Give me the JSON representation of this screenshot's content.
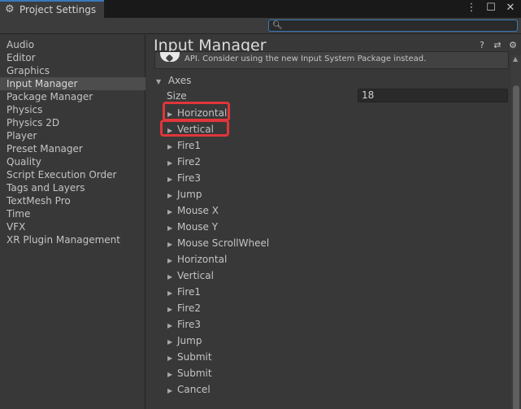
{
  "window": {
    "tab_title": "Project Settings",
    "tab_icon": "gear-icon",
    "controls": [
      "more-vert-icon",
      "maximize-icon",
      "close-icon"
    ]
  },
  "search": {
    "placeholder": "",
    "value": ""
  },
  "sidebar": {
    "items": [
      {
        "label": "Audio"
      },
      {
        "label": "Editor"
      },
      {
        "label": "Graphics"
      },
      {
        "label": "Input Manager",
        "selected": true
      },
      {
        "label": "Package Manager"
      },
      {
        "label": "Physics"
      },
      {
        "label": "Physics 2D"
      },
      {
        "label": "Player"
      },
      {
        "label": "Preset Manager"
      },
      {
        "label": "Quality"
      },
      {
        "label": "Script Execution Order"
      },
      {
        "label": "Tags and Layers"
      },
      {
        "label": "TextMesh Pro"
      },
      {
        "label": "Time"
      },
      {
        "label": "VFX"
      },
      {
        "label": "XR Plugin Management"
      }
    ]
  },
  "main": {
    "title": "Input Manager",
    "header_icons": [
      "help-icon",
      "preset-icon",
      "settings-icon"
    ],
    "info_text": "API. Consider using the new Input System Package instead.",
    "axes_label": "Axes",
    "size_label": "Size",
    "size_value": "18",
    "axes": [
      {
        "label": "Horizontal",
        "highlighted": true
      },
      {
        "label": "Vertical",
        "highlighted": true
      },
      {
        "label": "Fire1"
      },
      {
        "label": "Fire2"
      },
      {
        "label": "Fire3"
      },
      {
        "label": "Jump"
      },
      {
        "label": "Mouse X"
      },
      {
        "label": "Mouse Y"
      },
      {
        "label": "Mouse ScrollWheel"
      },
      {
        "label": "Horizontal"
      },
      {
        "label": "Vertical"
      },
      {
        "label": "Fire1"
      },
      {
        "label": "Fire2"
      },
      {
        "label": "Fire3"
      },
      {
        "label": "Jump"
      },
      {
        "label": "Submit"
      },
      {
        "label": "Submit"
      },
      {
        "label": "Cancel"
      }
    ]
  },
  "colors": {
    "accent": "#3a79bb",
    "highlight_border": "#e0363a",
    "panel_bg": "#383838",
    "selected_bg": "#4d4d4d"
  }
}
